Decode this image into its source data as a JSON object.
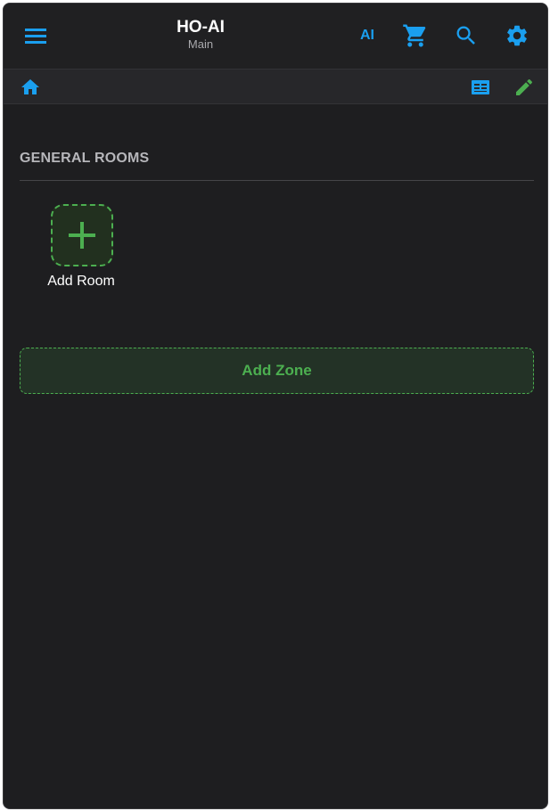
{
  "header": {
    "title": "HO-AI",
    "subtitle": "Main",
    "ai_label": "AI",
    "icons": {
      "menu": "menu-icon",
      "cart": "cart-icon",
      "search": "search-icon",
      "settings": "gear-icon"
    },
    "accent_color": "#1a9fef"
  },
  "subbar": {
    "icons": {
      "home": "home-icon",
      "view": "list-view-icon",
      "edit": "pencil-icon"
    },
    "edit_color": "#4caf50"
  },
  "main": {
    "section_title": "GENERAL ROOMS",
    "add_room_label": "Add Room",
    "add_zone_label": "Add Zone",
    "add_color": "#4caf50"
  }
}
